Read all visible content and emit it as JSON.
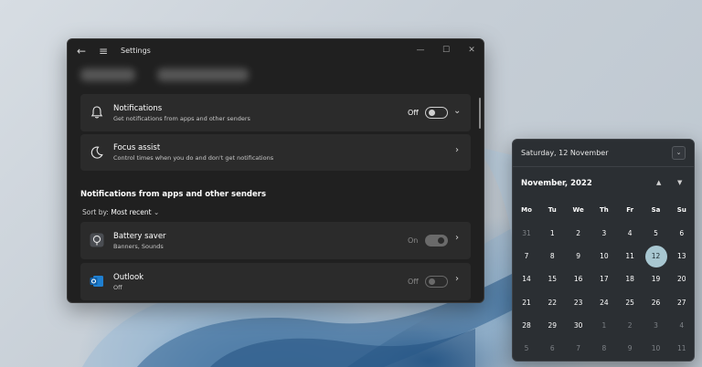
{
  "settings": {
    "title": "Settings",
    "heading": "System > Notifications",
    "notifications": {
      "title": "Notifications",
      "subtitle": "Get notifications from apps and other senders",
      "state": "Off"
    },
    "focus_assist": {
      "title": "Focus assist",
      "subtitle": "Control times when you do and don't get notifications"
    },
    "section_title": "Notifications from apps and other senders",
    "sort_label": "Sort by:",
    "sort_value": "Most recent",
    "apps": [
      {
        "name": "Battery saver",
        "subtitle": "Banners, Sounds",
        "state": "On"
      },
      {
        "name": "Outlook",
        "subtitle": "Off",
        "state": "Off"
      }
    ]
  },
  "calendar": {
    "header_date": "Saturday, 12 November",
    "month": "November, 2022",
    "weekdays": [
      "Mo",
      "Tu",
      "We",
      "Th",
      "Fr",
      "Sa",
      "Su"
    ],
    "weeks": [
      [
        "31",
        "1",
        "2",
        "3",
        "4",
        "5",
        "6"
      ],
      [
        "7",
        "8",
        "9",
        "10",
        "11",
        "12",
        "13"
      ],
      [
        "14",
        "15",
        "16",
        "17",
        "18",
        "19",
        "20"
      ],
      [
        "21",
        "22",
        "23",
        "24",
        "25",
        "26",
        "27"
      ],
      [
        "28",
        "29",
        "30",
        "1",
        "2",
        "3",
        "4"
      ],
      [
        "5",
        "6",
        "7",
        "8",
        "9",
        "10",
        "11"
      ]
    ],
    "today": "12"
  },
  "colors": {
    "accent": "#a8c7d1",
    "window_bg": "#202020",
    "card_bg": "#2b2b2b",
    "calendar_bg": "#2b2f33"
  }
}
